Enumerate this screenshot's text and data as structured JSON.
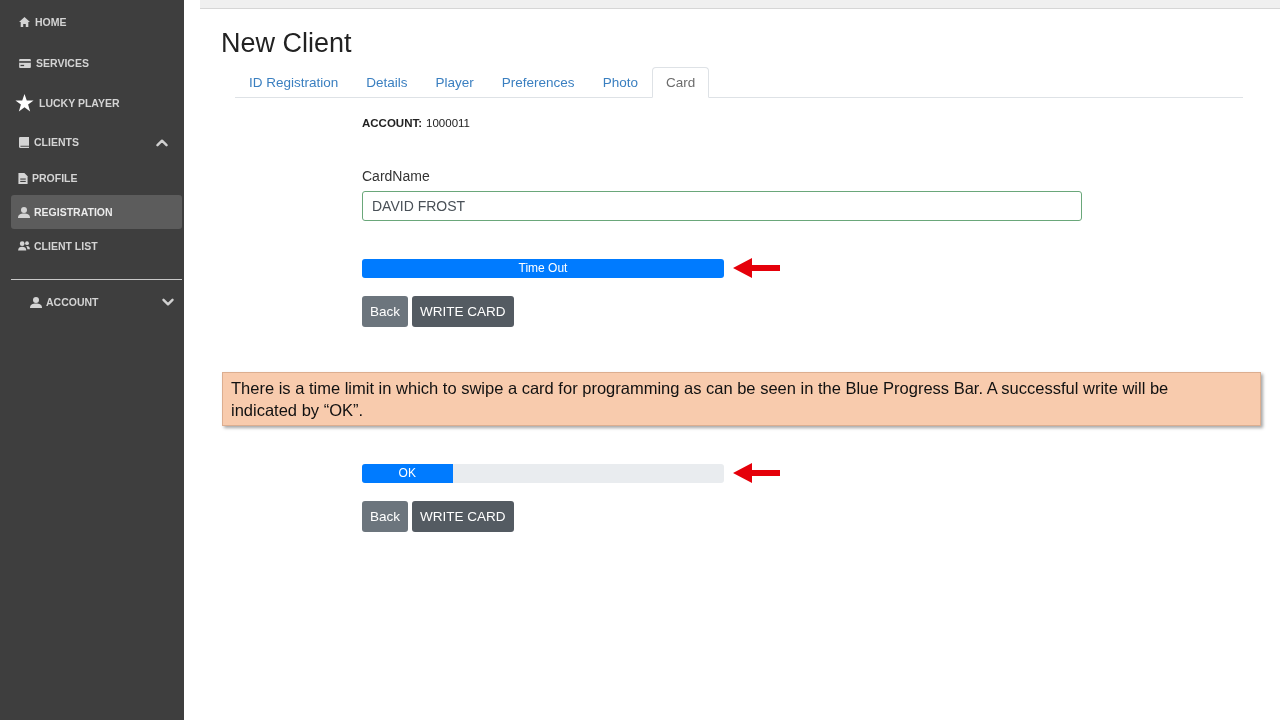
{
  "sidebar": {
    "items": [
      {
        "label": "HOME",
        "selected": false
      },
      {
        "label": "SERVICES",
        "selected": false
      },
      {
        "label": "LUCKY PLAYER",
        "selected": false
      },
      {
        "label": "CLIENTS",
        "selected": false,
        "expanded": true,
        "children": [
          {
            "label": "PROFILE",
            "selected": false
          },
          {
            "label": "REGISTRATION",
            "selected": true
          },
          {
            "label": "CLIENT LIST",
            "selected": false
          }
        ]
      }
    ],
    "account_menu": {
      "label": "ACCOUNT",
      "expanded": false
    }
  },
  "page": {
    "title": "New Client"
  },
  "tabs": [
    {
      "label": "ID Registration",
      "selected": false
    },
    {
      "label": "Details",
      "selected": false
    },
    {
      "label": "Player",
      "selected": false
    },
    {
      "label": "Preferences",
      "selected": false
    },
    {
      "label": "Photo",
      "selected": false
    },
    {
      "label": "Card",
      "selected": true
    }
  ],
  "account": {
    "label": "ACCOUNT:",
    "number": "1000011"
  },
  "card_name": {
    "label": "CardName",
    "value": "DAVID FROST"
  },
  "sections": [
    {
      "kind": "write_panel",
      "progress": {
        "label": "Time Out",
        "level": 1
      },
      "buttons": [
        {
          "label": "Back",
          "kind": "secondary"
        },
        {
          "label": "WRITE CARD",
          "kind": "dark"
        }
      ]
    },
    {
      "kind": "note",
      "text": "There is a time limit in which to swipe a card for programming as can be seen in the Blue Progress Bar. A successful write will be indicated by “OK”."
    },
    {
      "kind": "write_panel",
      "progress": {
        "label": "OK",
        "level": 0.25
      },
      "buttons": [
        {
          "label": "Back",
          "kind": "secondary"
        },
        {
          "label": "WRITE CARD",
          "kind": "dark"
        }
      ]
    }
  ]
}
